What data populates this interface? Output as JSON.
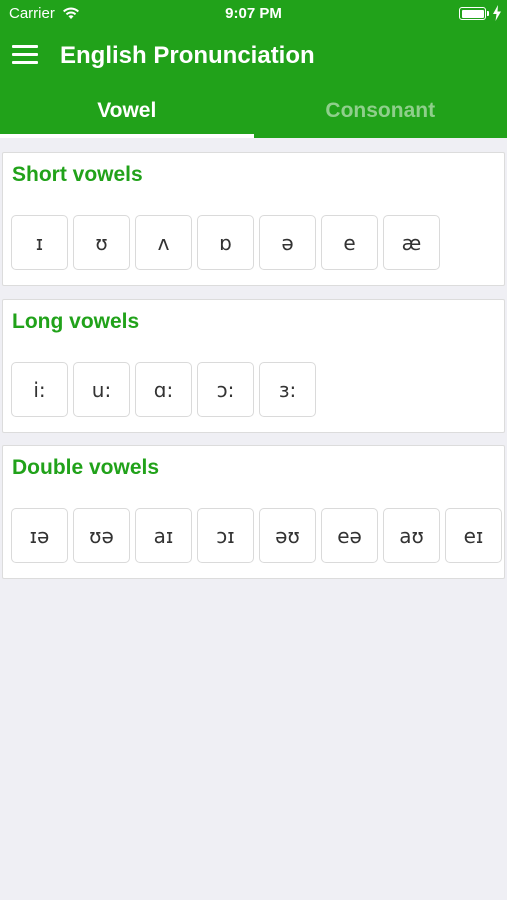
{
  "status_bar": {
    "carrier": "Carrier",
    "time": "9:07 PM",
    "wifi_icon": "wifi-icon",
    "battery_icon": "battery-icon",
    "battery_level": 1.0
  },
  "navbar": {
    "menu_icon": "hamburger-menu-icon",
    "title": "English Pronunciation"
  },
  "tabs": [
    {
      "label": "Vowel",
      "active": true
    },
    {
      "label": "Consonant",
      "active": false
    }
  ],
  "sections": [
    {
      "title": "Short vowels",
      "sounds": [
        "ɪ",
        "ʊ",
        "ʌ",
        "ɒ",
        "ə",
        "e",
        "æ"
      ]
    },
    {
      "title": "Long vowels",
      "sounds": [
        "i:",
        "u:",
        "ɑ:",
        "ɔ:",
        "ɜ:"
      ]
    },
    {
      "title": "Double vowels",
      "sounds": [
        "ɪə",
        "ʊə",
        "aɪ",
        "ɔɪ",
        "əʊ",
        "eə",
        "aʊ",
        "eɪ"
      ]
    }
  ],
  "colors": {
    "brand_green": "#21a21a",
    "inactive_tab": "#8fcf8b",
    "background": "#efeff4"
  }
}
